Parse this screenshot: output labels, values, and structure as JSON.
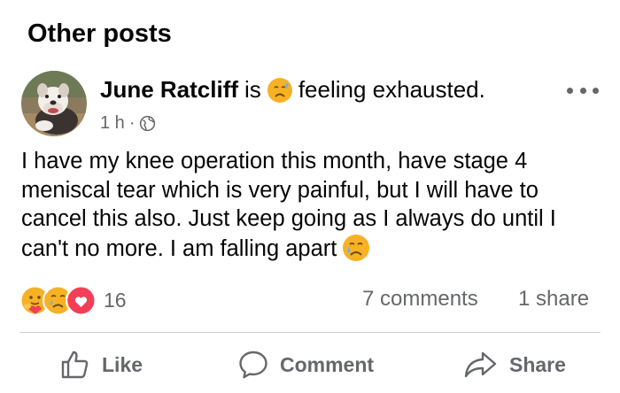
{
  "section": {
    "title": "Other posts"
  },
  "post": {
    "author": "June Ratcliff",
    "is_word": "is",
    "feeling_text": "feeling exhausted.",
    "feeling_icon": "sad-sweat-face-emoji",
    "time": "1 h",
    "dot": "·",
    "audience_icon": "globe-icon",
    "body": "I have my knee operation this month, have stage 4 meniscal tear which is very painful, but I will have to cancel this also.  Just keep going as I always do until I can't no more.   I am falling apart",
    "body_emoji": "crying-face-emoji",
    "avatar_icon": "dog-avatar"
  },
  "stats": {
    "reactions": [
      "care",
      "sad",
      "love"
    ],
    "reaction_count": "16",
    "comments": "7 comments",
    "shares": "1 share"
  },
  "actions": {
    "like": "Like",
    "comment": "Comment",
    "share": "Share"
  },
  "colors": {
    "text": "#050505",
    "secondary": "#65676b",
    "divider": "#ced0d4",
    "love": "#f33e58",
    "emoji": "#f7b125"
  }
}
